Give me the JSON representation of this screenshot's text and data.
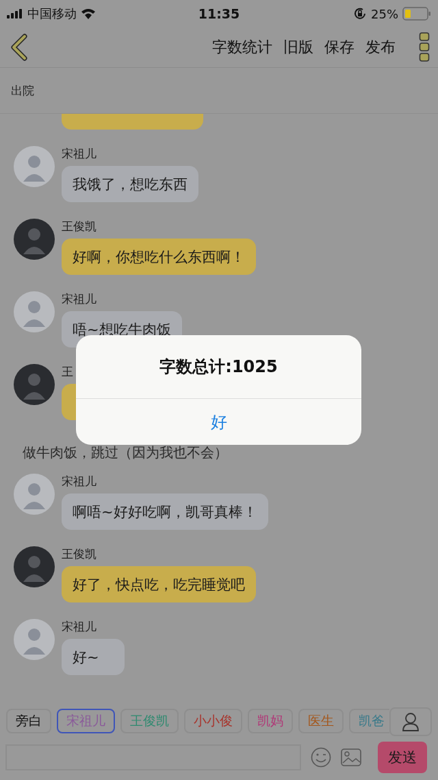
{
  "status_bar": {
    "carrier": "中国移动",
    "time": "11:35",
    "battery": "25%"
  },
  "header": {
    "actions": [
      "字数统计",
      "旧版",
      "保存",
      "发布"
    ]
  },
  "scene": {
    "title": "出院"
  },
  "messages": [
    {
      "kind": "partial"
    },
    {
      "kind": "speaker1",
      "name": "宋祖儿",
      "text": "我饿了，想吃东西"
    },
    {
      "kind": "speaker2",
      "name": "王俊凯",
      "text": "好啊，你想吃什么东西啊！"
    },
    {
      "kind": "speaker1",
      "name": "宋祖儿",
      "text": "唔~想吃牛肉饭"
    },
    {
      "kind": "speaker2",
      "name": "王"
    },
    {
      "kind": "narration",
      "text": "做牛肉饭，跳过（因为我也不会）"
    },
    {
      "kind": "speaker1",
      "name": "宋祖儿",
      "text": "啊唔~好好吃啊，凯哥真棒！"
    },
    {
      "kind": "speaker2",
      "name": "王俊凯",
      "text": "好了，快点吃，吃完睡觉吧"
    },
    {
      "kind": "speaker1",
      "name": "宋祖儿",
      "text": "好~"
    }
  ],
  "characters": [
    {
      "label": "旁白",
      "color": "#111111",
      "selected": false
    },
    {
      "label": "宋祖儿",
      "color": "#8a5a9a",
      "selected": true
    },
    {
      "label": "王俊凯",
      "color": "#2f8a70",
      "selected": false
    },
    {
      "label": "小小俊",
      "color": "#a8322a",
      "selected": false
    },
    {
      "label": "凯妈",
      "color": "#b03a78",
      "selected": false
    },
    {
      "label": "医生",
      "color": "#a4561a",
      "selected": false
    },
    {
      "label": "凯爸",
      "color": "#3a7a8a",
      "selected": false
    }
  ],
  "composer": {
    "send": "发送"
  },
  "alert": {
    "title": "字数总计:1025",
    "button": "好"
  }
}
